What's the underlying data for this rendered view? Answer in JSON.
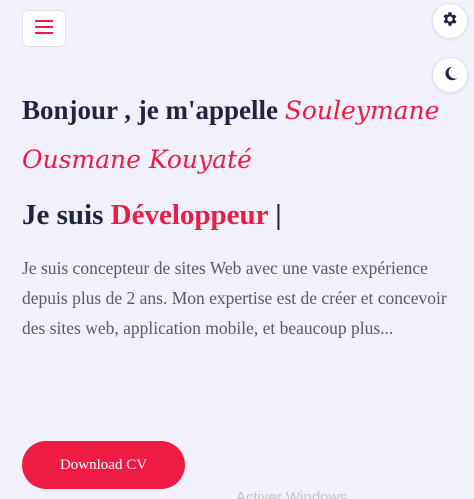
{
  "header": {
    "menu_icon": "hamburger-menu-icon",
    "settings_icon": "gear-icon",
    "theme_icon": "moon-icon"
  },
  "hero": {
    "greeting": "Bonjour , je m'appelle",
    "name": "Souleymane Ousmane Kouyaté",
    "role_prefix": "Je suis",
    "role": "Développeur",
    "cursor": "|",
    "intro": "Je suis concepteur de sites Web avec une vaste expérience depuis plus de 2 ans. Mon expertise est de créer et concevoir des sites web, application mobile, et beaucoup plus...",
    "cv_button": "Download CV"
  },
  "overlay": {
    "watermark": "Activer Windows"
  },
  "colors": {
    "accent": "#ee1b44",
    "heading": "#1f2541",
    "body_text": "#565a6d",
    "background": "#f2f0fa"
  }
}
